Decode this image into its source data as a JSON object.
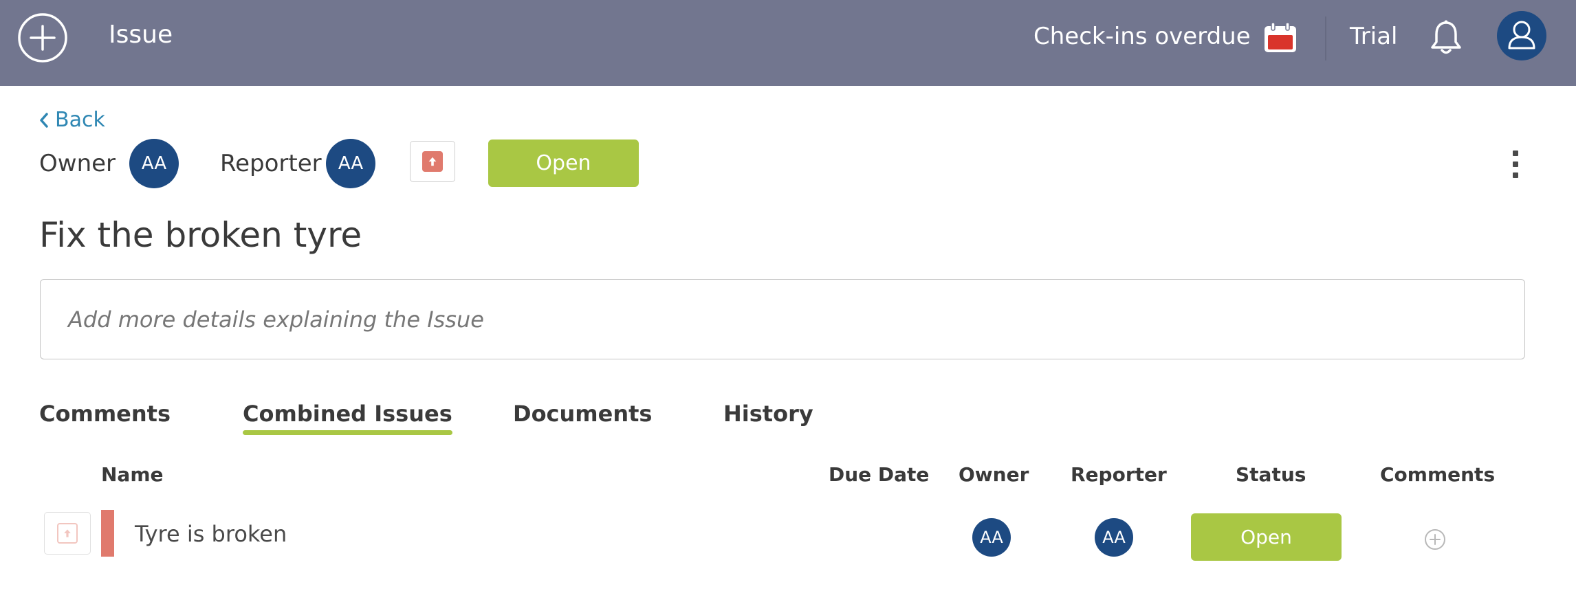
{
  "topbar": {
    "title": "Issue",
    "checkins_label": "Check-ins overdue",
    "trial_label": "Trial"
  },
  "header": {
    "back_label": "Back",
    "owner_label": "Owner",
    "owner_initials": "AA",
    "reporter_label": "Reporter",
    "reporter_initials": "AA",
    "status_label": "Open"
  },
  "issue": {
    "title": "Fix the broken tyre",
    "details_placeholder": "Add more details explaining the Issue"
  },
  "tabs": [
    {
      "label": "Comments"
    },
    {
      "label": "Combined Issues",
      "active": true
    },
    {
      "label": "Documents"
    },
    {
      "label": "History"
    }
  ],
  "table": {
    "columns": [
      "Name",
      "Due Date",
      "Owner",
      "Reporter",
      "Status",
      "Comments"
    ],
    "rows": [
      {
        "name": "Tyre is broken",
        "due_date": "",
        "owner_initials": "AA",
        "reporter_initials": "AA",
        "status": "Open"
      }
    ]
  },
  "colors": {
    "topbar": "#72768f",
    "accent_green": "#a9c744",
    "avatar_blue": "#1d4a82",
    "priority_red": "#e07a6d",
    "link_blue": "#2f87b3"
  },
  "icons": [
    "plus-circle-icon",
    "calendar-icon",
    "bell-icon",
    "user-icon",
    "chevron-left-icon",
    "priority-up-icon",
    "kebab-menu-icon",
    "plus-circle-small-icon"
  ]
}
